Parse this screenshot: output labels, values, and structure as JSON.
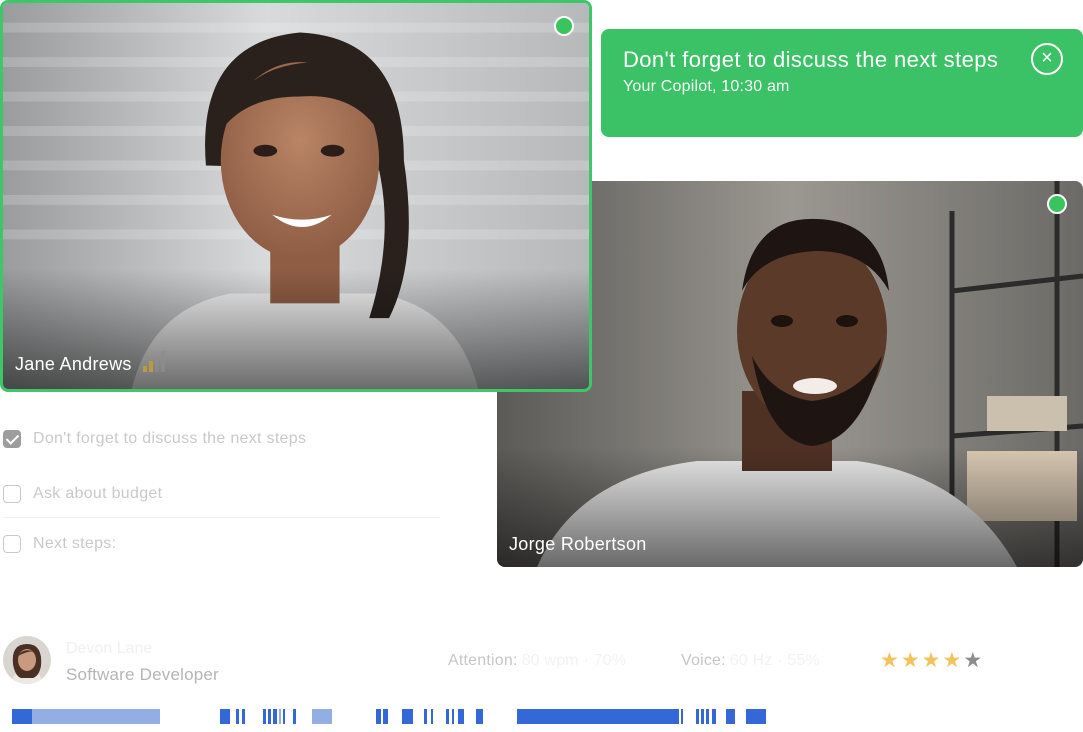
{
  "participants": {
    "jane": {
      "name": "Jane Andrews",
      "status_color": "#3ac45e",
      "active_speaker": true
    },
    "jorge": {
      "name": "Jorge Robertson",
      "status_color": "#3ac45e"
    }
  },
  "notification": {
    "message": "Don't forget to discuss the next steps",
    "source": "Your Copilot, 10:30 am",
    "close_icon": "close-circle-icon",
    "color": "#3cc266"
  },
  "tasks": [
    {
      "label": "Don't forget to discuss the next steps",
      "checked": true
    },
    {
      "label": "Ask about budget",
      "checked": false
    },
    {
      "label": "Next steps:",
      "checked": false
    }
  ],
  "contact": {
    "name": "Devon Lane",
    "role": "Software Developer",
    "attention_label": "Attention:",
    "attention_value": "80 wpm · 70%",
    "voice_label": "Voice:",
    "voice_value": "60 Hz · 55%",
    "rating": 4,
    "rating_max": 5
  },
  "timeline_colors": {
    "dark": "#3468d6",
    "light": "#93aee3"
  }
}
